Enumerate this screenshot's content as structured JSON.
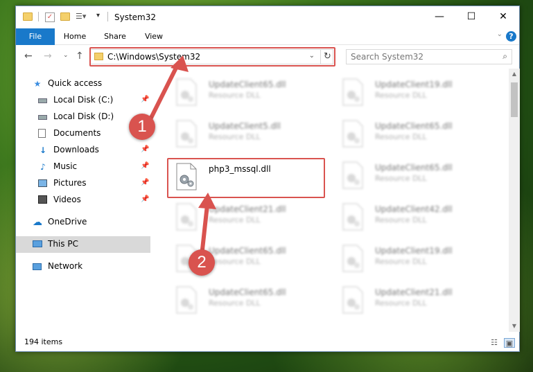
{
  "window": {
    "title": "System32",
    "controls": {
      "minimize": "—",
      "maximize": "☐",
      "close": "✕"
    }
  },
  "ribbon": {
    "tabs": [
      "File",
      "Home",
      "Share",
      "View"
    ],
    "help": "?"
  },
  "navigation": {
    "address": "C:\\Windows\\System32",
    "search_placeholder": "Search System32"
  },
  "sidebar": {
    "items": [
      {
        "label": "Quick access",
        "icon": "star-icon",
        "pinned": false
      },
      {
        "label": "Local Disk (C:)",
        "icon": "drive-icon",
        "pinned": true
      },
      {
        "label": "Local Disk (D:)",
        "icon": "drive-icon",
        "pinned": false
      },
      {
        "label": "Documents",
        "icon": "documents-icon",
        "pinned": true
      },
      {
        "label": "Downloads",
        "icon": "download-arrow-icon",
        "pinned": true
      },
      {
        "label": "Music",
        "icon": "music-note-icon",
        "pinned": true
      },
      {
        "label": "Pictures",
        "icon": "pictures-icon",
        "pinned": true
      },
      {
        "label": "Videos",
        "icon": "videos-icon",
        "pinned": true
      },
      {
        "label": "OneDrive",
        "icon": "cloud-icon",
        "pinned": false
      },
      {
        "label": "This PC",
        "icon": "computer-icon",
        "pinned": false,
        "selected": true
      },
      {
        "label": "Network",
        "icon": "network-icon",
        "pinned": false
      }
    ]
  },
  "files": [
    {
      "name": "UpdateClient65.dll",
      "type": "Resource DLL",
      "blurred": true
    },
    {
      "name": "UpdateClient19.dll",
      "type": "Resource DLL",
      "blurred": true
    },
    {
      "name": "UpdateClient5.dll",
      "type": "Resource DLL",
      "blurred": true
    },
    {
      "name": "UpdateClient65.dll",
      "type": "Resource DLL",
      "blurred": true
    },
    {
      "name": "php3_mssql.dll",
      "type": "",
      "blurred": false,
      "highlighted": true
    },
    {
      "name": "UpdateClient65.dll",
      "type": "Resource DLL",
      "blurred": true
    },
    {
      "name": "UpdateClient21.dll",
      "type": "Resource DLL",
      "blurred": true
    },
    {
      "name": "UpdateClient42.dll",
      "type": "Resource DLL",
      "blurred": true
    },
    {
      "name": "UpdateClient65.dll",
      "type": "Resource DLL",
      "blurred": true
    },
    {
      "name": "UpdateClient19.dll",
      "type": "Resource DLL",
      "blurred": true
    },
    {
      "name": "UpdateClient65.dll",
      "type": "Resource DLL",
      "blurred": true
    },
    {
      "name": "UpdateClient21.dll",
      "type": "Resource DLL",
      "blurred": true
    }
  ],
  "status": {
    "item_count": "194 items"
  },
  "annotations": {
    "step1": "1",
    "step2": "2",
    "color": "#d9534f"
  },
  "colors": {
    "accent": "#1979ca",
    "highlight": "#d9534f",
    "selection": "#d9d9d9"
  }
}
